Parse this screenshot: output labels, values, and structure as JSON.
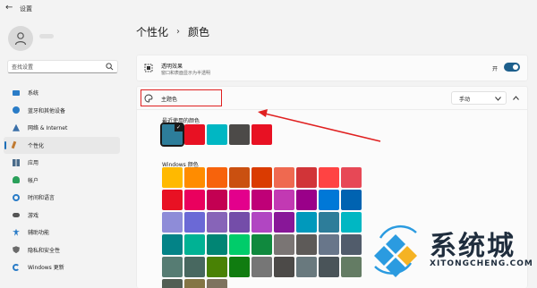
{
  "window": {
    "title": "设置"
  },
  "search": {
    "placeholder": "查找设置"
  },
  "sidebar": {
    "items": [
      {
        "label": "系统",
        "icon": "monitor-icon",
        "color": "#2a7cc7"
      },
      {
        "label": "蓝牙和其他设备",
        "icon": "bluetooth-icon",
        "color": "#2a7cc7"
      },
      {
        "label": "网络 & Internet",
        "icon": "network-icon",
        "color": "#3a6fa8"
      },
      {
        "label": "个性化",
        "icon": "brush-icon",
        "color": "#c07a30",
        "active": true
      },
      {
        "label": "应用",
        "icon": "apps-icon",
        "color": "#4a6b8a"
      },
      {
        "label": "帐户",
        "icon": "account-icon",
        "color": "#2aa05a"
      },
      {
        "label": "时间和语言",
        "icon": "globe-clock-icon",
        "color": "#2a7cc7"
      },
      {
        "label": "游戏",
        "icon": "gamepad-icon",
        "color": "#555555"
      },
      {
        "label": "辅助功能",
        "icon": "accessibility-icon",
        "color": "#2a7cc7"
      },
      {
        "label": "隐私和安全性",
        "icon": "shield-icon",
        "color": "#6a6a6a"
      },
      {
        "label": "Windows 更新",
        "icon": "update-icon",
        "color": "#2a7cc7"
      }
    ]
  },
  "header": {
    "parent": "个性化",
    "separator": "›",
    "current": "颜色"
  },
  "transparency": {
    "title": "透明效果",
    "description": "窗口和表面显示为半透明",
    "state_label": "开",
    "on": true
  },
  "theme_color": {
    "label": "主题色",
    "mode": "手动",
    "recent_label": "最近使用的颜色",
    "recent_colors": [
      "#2d7d9a",
      "#e81123",
      "#00b7c3",
      "#4c4a48",
      "#e81123"
    ],
    "windows_label": "Windows 颜色",
    "windows_colors": [
      [
        "#ffb900",
        "#ff8c00",
        "#f7630c",
        "#ca5010",
        "#da3b01",
        "#ef6950",
        "#d13438",
        "#ff4343",
        "#e74856"
      ],
      [
        "#e81123",
        "#ea005e",
        "#c30052",
        "#e3008c",
        "#bf0077",
        "#c239b3",
        "#9a0089",
        "#0078d7",
        "#0063b1"
      ],
      [
        "#8e8cd8",
        "#6b69d6",
        "#8764b8",
        "#744da9",
        "#b146c2",
        "#881798",
        "#0099bc",
        "#2d7d9a",
        "#00b7c3"
      ],
      [
        "#038387",
        "#00b294",
        "#018574",
        "#00cc6a",
        "#10893e",
        "#7a7574",
        "#5d5a58",
        "#68768a",
        "#515c6b"
      ],
      [
        "#567c73",
        "#486860",
        "#498205",
        "#107c10",
        "#767676",
        "#4c4a48",
        "#69797e",
        "#4a5459",
        "#647c64"
      ],
      [
        "#525e54",
        "#847545",
        "#7e735f"
      ]
    ]
  },
  "watermark": {
    "text": "系统城",
    "subtext": "XITONGCHENG.COM"
  }
}
